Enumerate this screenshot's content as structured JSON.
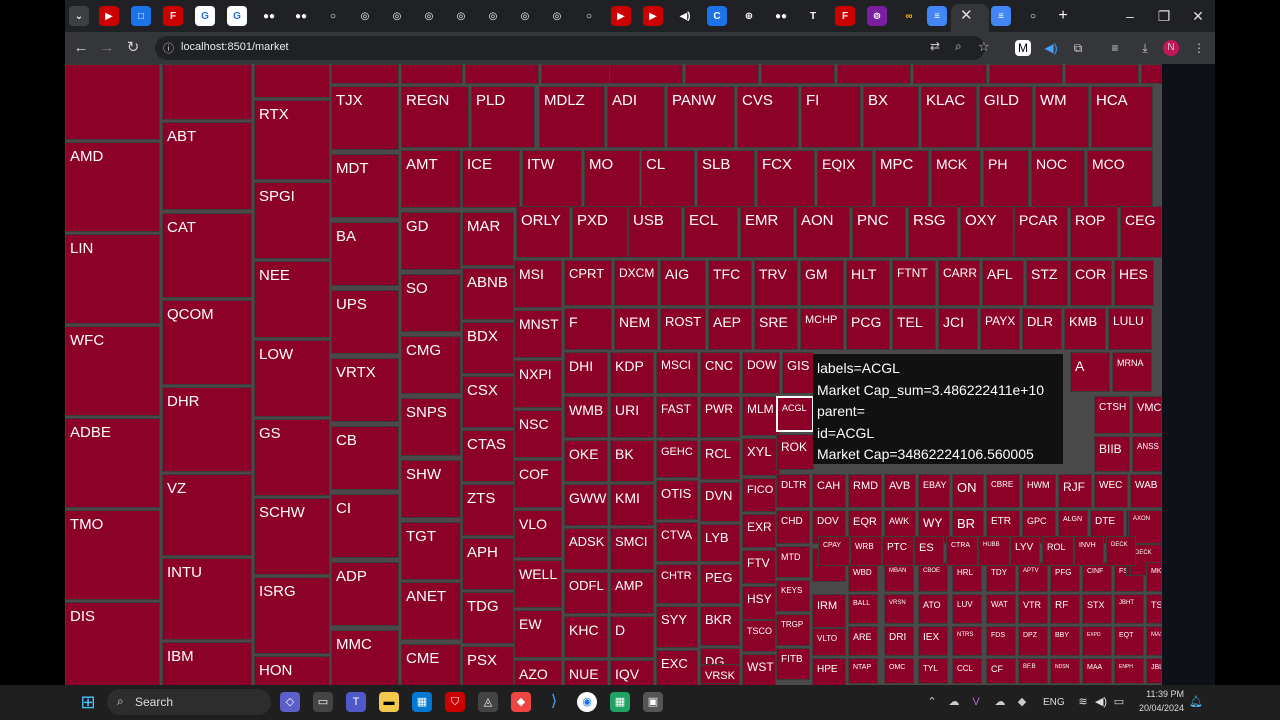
{
  "browser": {
    "url": "localhost:8501/market",
    "tabs": [
      "youtube",
      "clipchamp",
      "figma",
      "google",
      "google",
      "app",
      "app",
      "app",
      "github",
      "github",
      "github",
      "github",
      "github",
      "github",
      "app",
      "youtube",
      "youtube",
      "audio",
      "c",
      "web",
      "app",
      "text",
      "figma",
      "app",
      "app",
      "docs",
      "docs",
      "app"
    ]
  },
  "treemap": {
    "cells": [
      [
        "",
        0,
        0,
        95,
        75,
        "sm"
      ],
      [
        "AMD",
        0,
        78,
        95,
        90,
        "md"
      ],
      [
        "LIN",
        0,
        170,
        95,
        90,
        "md"
      ],
      [
        "WFC",
        0,
        262,
        95,
        90,
        "md"
      ],
      [
        "ADBE",
        0,
        354,
        95,
        90,
        "md"
      ],
      [
        "TMO",
        0,
        446,
        95,
        90,
        "md"
      ],
      [
        "DIS",
        0,
        538,
        95,
        90,
        "md"
      ],
      [
        "",
        97,
        0,
        90,
        55,
        "sm"
      ],
      [
        "ABT",
        97,
        59,
        90,
        88,
        "md"
      ],
      [
        "CAT",
        97,
        151,
        90,
        83,
        "md"
      ],
      [
        "QCOM",
        97,
        237,
        90,
        83,
        "md"
      ],
      [
        "DHR",
        97,
        323,
        90,
        83,
        "md"
      ],
      [
        "VZ",
        97,
        409,
        90,
        80,
        "md"
      ],
      [
        "INTU",
        97,
        492,
        90,
        80,
        "md"
      ],
      [
        "IBM",
        97,
        575,
        90,
        80,
        "md"
      ],
      [
        "",
        189,
        0,
        76,
        34,
        "sm"
      ],
      [
        "RTX",
        189,
        36,
        76,
        78,
        "md"
      ],
      [
        "SPGI",
        189,
        118,
        76,
        76,
        "md"
      ],
      [
        "NEE",
        189,
        197,
        76,
        76,
        "md"
      ],
      [
        "LOW",
        189,
        276,
        76,
        76,
        "md"
      ],
      [
        "GS",
        189,
        355,
        76,
        76,
        "md"
      ],
      [
        "SCHW",
        189,
        434,
        76,
        76,
        "md"
      ],
      [
        "ISRG",
        189,
        513,
        76,
        76,
        "md"
      ],
      [
        "HON",
        189,
        591,
        76,
        76,
        "md"
      ],
      [
        "",
        265,
        0,
        70,
        20,
        "sm"
      ],
      [
        "TJX",
        266,
        23,
        68,
        62,
        "md"
      ],
      [
        "MDT",
        266,
        91,
        68,
        62,
        "md"
      ],
      [
        "BA",
        266,
        159,
        68,
        62,
        "md"
      ],
      [
        "UPS",
        266,
        226,
        68,
        62,
        "md"
      ],
      [
        "VRTX",
        266,
        294,
        68,
        62,
        "md"
      ],
      [
        "CB",
        266,
        362,
        68,
        62,
        "md"
      ],
      [
        "CI",
        266,
        430,
        68,
        62,
        "md"
      ],
      [
        "ADP",
        266,
        498,
        68,
        62,
        "md"
      ],
      [
        "MMC",
        266,
        566,
        68,
        62,
        "md"
      ],
      [
        "",
        336,
        0,
        1,
        20,
        "sm"
      ],
      [
        "",
        336,
        0,
        60,
        20,
        "sm"
      ],
      [
        "REGN",
        336,
        23,
        60,
        60,
        "md"
      ],
      [
        "AMT",
        336,
        87,
        60,
        55,
        "md"
      ],
      [
        "GD",
        336,
        148,
        60,
        58,
        "md"
      ],
      [
        "SO",
        336,
        210,
        60,
        58,
        "md"
      ],
      [
        "CMG",
        336,
        272,
        60,
        58,
        "md"
      ],
      [
        "SNPS",
        336,
        334,
        60,
        58,
        "md"
      ],
      [
        "SHW",
        336,
        395,
        60,
        58,
        "md"
      ],
      [
        "TGT",
        336,
        456,
        60,
        58,
        "md"
      ],
      [
        "ANET",
        336,
        517,
        60,
        58,
        "md"
      ],
      [
        "CME",
        336,
        578,
        60,
        58,
        "md"
      ],
      [
        "",
        398,
        0,
        74,
        20,
        "sm"
      ],
      [
        "PLD",
        404,
        23,
        66,
        60,
        "md"
      ],
      [
        "ICE",
        396,
        87,
        66,
        55,
        "md"
      ],
      [
        "MAR",
        396,
        142,
        52,
        55,
        "md"
      ],
      [
        "ABNB",
        396,
        198,
        52,
        54,
        "md"
      ],
      [
        "BDX",
        396,
        254,
        52,
        54,
        "md"
      ],
      [
        "CSX",
        396,
        310,
        52,
        54,
        "md"
      ],
      [
        "CTAS",
        396,
        366,
        52,
        54,
        "md"
      ],
      [
        "ZTS",
        396,
        422,
        52,
        54,
        "md"
      ],
      [
        "APH",
        396,
        478,
        52,
        54,
        "md"
      ],
      [
        "TDG",
        396,
        534,
        52,
        54,
        "md"
      ],
      [
        "PSX",
        396,
        590,
        52,
        54,
        "md"
      ],
      [
        "",
        474,
        0,
        70,
        20,
        "sm"
      ],
      [
        "MDLZ",
        474,
        23,
        68,
        60,
        "md"
      ],
      [
        "ITW",
        456,
        87,
        60,
        55,
        "md"
      ],
      [
        "MO",
        517,
        87,
        60,
        55,
        "md"
      ],
      [
        "ORLY",
        450,
        142,
        55,
        55,
        "md"
      ],
      [
        "PXD",
        506,
        142,
        55,
        55,
        "md"
      ],
      [
        "MSI",
        448,
        198,
        50,
        46,
        "md"
      ],
      [
        "MNST",
        448,
        246,
        50,
        46,
        "md"
      ],
      [
        "NXPI",
        448,
        294,
        50,
        46,
        "md"
      ],
      [
        "NSC",
        448,
        342,
        50,
        46,
        "md"
      ],
      [
        "COF",
        448,
        390,
        50,
        46,
        "md"
      ],
      [
        "VLO",
        448,
        438,
        50,
        46,
        "md"
      ],
      [
        "WELL",
        448,
        486,
        50,
        46,
        "md"
      ],
      [
        "EW",
        448,
        534,
        50,
        46,
        "md"
      ],
      [
        "AZO",
        448,
        582,
        50,
        46,
        "md"
      ]
    ]
  },
  "tooltip": {
    "line1": "labels=ACGL",
    "line2": "Market Cap_sum=3.486222411e+10",
    "line3": "parent=",
    "line4": "id=ACGL",
    "line5": "Market Cap=34862224106.560005"
  },
  "taskbar": {
    "search_label": "Search",
    "lang": "ENG",
    "time": "11:39 PM",
    "date": "20/04/2024"
  },
  "colors": {
    "cell": "#8c0127",
    "border": "#3c3c3c",
    "bg": "#0e1117"
  }
}
